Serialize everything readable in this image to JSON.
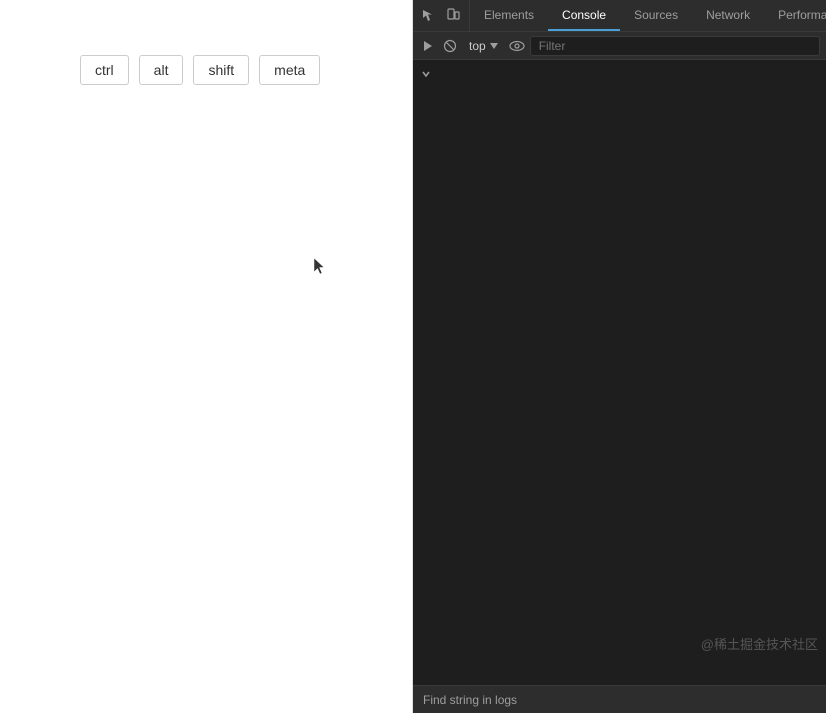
{
  "left_panel": {
    "keys": [
      "ctrl",
      "alt",
      "shift",
      "meta"
    ]
  },
  "devtools": {
    "tabs": [
      "Elements",
      "Console",
      "Sources",
      "Network",
      "Performan..."
    ],
    "active_tab": "Console",
    "toolbar2": {
      "top_label": "top",
      "filter_placeholder": "Filter"
    },
    "watermark": "@稀土掘金技术社区",
    "find_bar_placeholder": "Find string in logs"
  }
}
